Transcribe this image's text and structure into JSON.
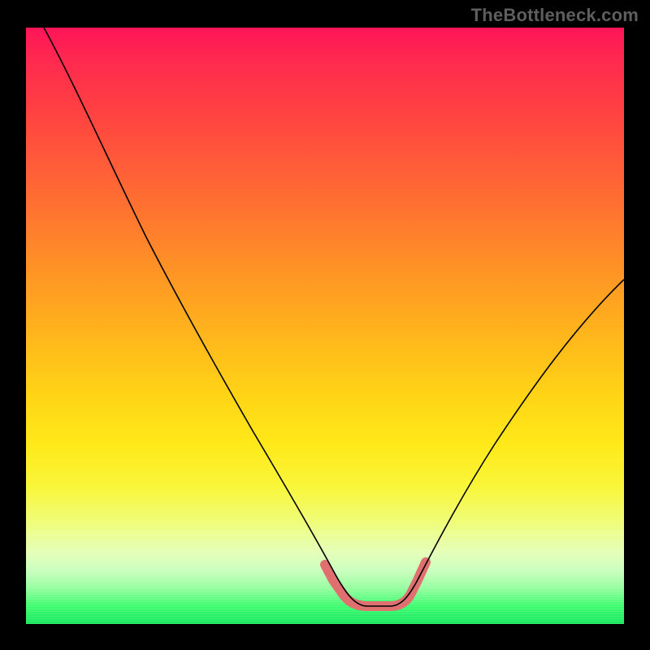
{
  "watermark": "TheBottleneck.com",
  "chart_data": {
    "type": "line",
    "title": "",
    "xlabel": "",
    "ylabel": "",
    "xlim": [
      0,
      100
    ],
    "ylim": [
      0,
      100
    ],
    "background_gradient_stops": [
      {
        "pos": 0.0,
        "color": "#ff1558"
      },
      {
        "pos": 0.14,
        "color": "#ff4142"
      },
      {
        "pos": 0.3,
        "color": "#ff7130"
      },
      {
        "pos": 0.46,
        "color": "#ffa420"
      },
      {
        "pos": 0.62,
        "color": "#ffd516"
      },
      {
        "pos": 0.77,
        "color": "#f9f63a"
      },
      {
        "pos": 0.88,
        "color": "#e4ffb6"
      },
      {
        "pos": 0.97,
        "color": "#3dfc6f"
      },
      {
        "pos": 1.0,
        "color": "#17e85e"
      }
    ],
    "series": [
      {
        "name": "bottleneck-curve",
        "x": [
          3,
          10,
          20,
          30,
          38,
          45,
          50,
          53,
          56,
          60,
          63,
          66,
          70,
          76,
          84,
          92,
          100
        ],
        "values": [
          100,
          85,
          65,
          46,
          32,
          20,
          10,
          5,
          3,
          3,
          5,
          8,
          14,
          22,
          34,
          46,
          58
        ]
      }
    ],
    "highlight_low_region": {
      "x_start": 50,
      "x_end": 66,
      "y_approx": 3,
      "color": "#e07070"
    },
    "grid": false,
    "legend": false
  }
}
